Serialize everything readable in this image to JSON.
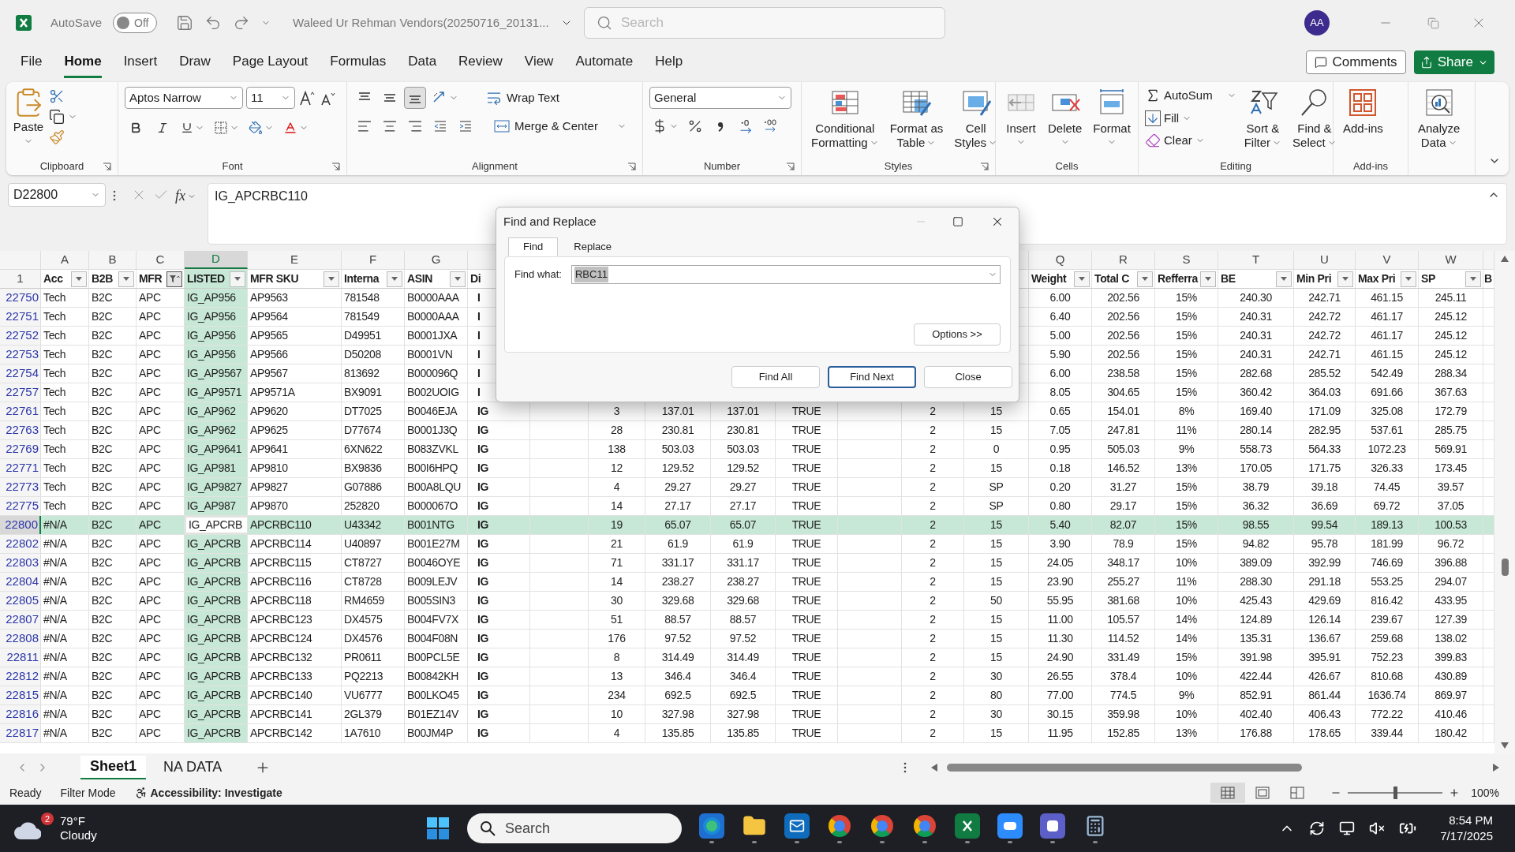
{
  "title_bar": {
    "autosave_label": "AutoSave",
    "autosave": {
      "on": false,
      "label": "Off"
    },
    "file_name": "Waleed Ur Rehman Vendors(20250716_20131...",
    "search": {
      "placeholder": "Search"
    },
    "avatar": "AA"
  },
  "menu_tabs": [
    {
      "label": "File",
      "selected": false
    },
    {
      "label": "Home",
      "selected": true
    },
    {
      "label": "Insert",
      "selected": false
    },
    {
      "label": "Draw",
      "selected": false
    },
    {
      "label": "Page Layout",
      "selected": false
    },
    {
      "label": "Formulas",
      "selected": false
    },
    {
      "label": "Data",
      "selected": false
    },
    {
      "label": "Review",
      "selected": false
    },
    {
      "label": "View",
      "selected": false
    },
    {
      "label": "Automate",
      "selected": false
    },
    {
      "label": "Help",
      "selected": false
    }
  ],
  "comments_button": "Comments",
  "share_button": "Share",
  "ribbon": {
    "clipboard": {
      "paste": "Paste",
      "label": "Clipboard"
    },
    "font": {
      "family": "Aptos Narrow",
      "size": "11",
      "label": "Font"
    },
    "alignment": {
      "vertical": [
        {
          "selected": false
        },
        {
          "selected": false
        },
        {
          "selected": true
        }
      ],
      "wrap": "Wrap Text",
      "merge": "Merge & Center",
      "label": "Alignment"
    },
    "number": {
      "format": "General",
      "label": "Number"
    },
    "styles": {
      "buttons": [
        {
          "kind": "conditional",
          "lines": [
            "Conditional",
            "Formatting"
          ]
        },
        {
          "kind": "table",
          "lines": [
            "Format as",
            "Table"
          ]
        },
        {
          "kind": "styles",
          "lines": [
            "Cell",
            "Styles"
          ]
        }
      ],
      "label": "Styles"
    },
    "cells": {
      "buttons": [
        {
          "kind": "insert",
          "lines": [
            "Insert"
          ]
        },
        {
          "kind": "delete",
          "lines": [
            "Delete"
          ]
        },
        {
          "kind": "format",
          "lines": [
            "Format"
          ]
        }
      ],
      "label": "Cells"
    },
    "editing": {
      "autosum": "AutoSum",
      "fill": "Fill",
      "clear": "Clear",
      "buttons": [
        {
          "kind": "sort",
          "lines": [
            "Sort &",
            "Filter"
          ]
        },
        {
          "kind": "find",
          "lines": [
            "Find &",
            "Select"
          ]
        }
      ],
      "label": "Editing"
    },
    "addins": {
      "buttons": [
        {
          "kind": "addins",
          "lines": [
            "Add-ins"
          ]
        }
      ],
      "label": "Add-ins"
    },
    "analyze": {
      "buttons": [
        {
          "kind": "analyze",
          "lines": [
            "Analyze",
            "Data"
          ]
        }
      ]
    }
  },
  "formula_bar": {
    "name_box": "D22800",
    "fx": "fx",
    "value": "IG_APCRBC110"
  },
  "columns": [
    {
      "letter": "A",
      "header": "Acc",
      "selected": false,
      "filtered": false
    },
    {
      "letter": "B",
      "header": "B2B",
      "selected": false,
      "filtered": false
    },
    {
      "letter": "C",
      "header": "MFR",
      "selected": false,
      "filtered": true
    },
    {
      "letter": "D",
      "header": "LISTED",
      "selected": true,
      "filtered": false
    },
    {
      "letter": "E",
      "header": "MFR SKU",
      "selected": false,
      "filtered": false
    },
    {
      "letter": "F",
      "header": "Interna",
      "selected": false,
      "filtered": false
    },
    {
      "letter": "G",
      "header": "ASIN",
      "selected": false,
      "filtered": false
    },
    {
      "header": "Di"
    },
    {},
    {},
    {},
    {},
    {},
    {},
    {},
    {},
    {
      "letter": "Q",
      "header": "Weight",
      "selected": false,
      "filtered": false
    },
    {
      "letter": "R",
      "header": "Total C",
      "selected": false,
      "filtered": false
    },
    {
      "letter": "S",
      "header": "Refferra",
      "selected": false,
      "filtered": false
    },
    {
      "letter": "T",
      "header": "BE",
      "selected": false,
      "filtered": false
    },
    {
      "letter": "U",
      "header": "Min Pri",
      "selected": false,
      "filtered": false
    },
    {
      "letter": "V",
      "header": "Max Pri",
      "selected": false,
      "filtered": false
    },
    {
      "letter": "W",
      "header": "SP",
      "selected": false,
      "filtered": false
    },
    {
      "header": "B"
    }
  ],
  "header_row_number": "1",
  "rows": [
    {
      "num": "22750",
      "selected": false,
      "cells": [
        "Tech",
        "B2C",
        "APC",
        "IG_AP956",
        "AP9563",
        "781548",
        "B0000AAA",
        "I",
        null,
        null,
        null,
        null,
        null,
        null,
        null,
        null,
        "6.00",
        "202.56",
        "15%",
        "240.30",
        "242.71",
        "461.15",
        "245.11"
      ]
    },
    {
      "num": "22751",
      "selected": false,
      "cells": [
        "Tech",
        "B2C",
        "APC",
        "IG_AP956",
        "AP9564",
        "781549",
        "B0000AAA",
        "I",
        null,
        null,
        null,
        null,
        null,
        null,
        null,
        null,
        "6.40",
        "202.56",
        "15%",
        "240.31",
        "242.72",
        "461.17",
        "245.12"
      ]
    },
    {
      "num": "22752",
      "selected": false,
      "cells": [
        "Tech",
        "B2C",
        "APC",
        "IG_AP956",
        "AP9565",
        "D49951",
        "B0001JXA",
        "I",
        null,
        null,
        null,
        null,
        null,
        null,
        null,
        null,
        "5.00",
        "202.56",
        "15%",
        "240.31",
        "242.72",
        "461.17",
        "245.12"
      ]
    },
    {
      "num": "22753",
      "selected": false,
      "cells": [
        "Tech",
        "B2C",
        "APC",
        "IG_AP956",
        "AP9566",
        "D50208",
        "B0001VN",
        "I",
        null,
        null,
        null,
        null,
        null,
        null,
        null,
        null,
        "5.90",
        "202.56",
        "15%",
        "240.31",
        "242.71",
        "461.15",
        "245.12"
      ]
    },
    {
      "num": "22754",
      "selected": false,
      "cells": [
        "Tech",
        "B2C",
        "APC",
        "IG_AP9567",
        "AP9567",
        "813692",
        "B000096Q",
        "I",
        null,
        null,
        null,
        null,
        null,
        null,
        null,
        null,
        "6.00",
        "238.58",
        "15%",
        "282.68",
        "285.52",
        "542.49",
        "288.34"
      ]
    },
    {
      "num": "22757",
      "selected": false,
      "cells": [
        "Tech",
        "B2C",
        "APC",
        "IG_AP9571",
        "AP9571A",
        "BX9091",
        "B002UOIG",
        "I",
        null,
        null,
        null,
        null,
        null,
        null,
        null,
        null,
        "8.05",
        "304.65",
        "15%",
        "360.42",
        "364.03",
        "691.66",
        "367.63"
      ]
    },
    {
      "num": "22761",
      "selected": false,
      "cells": [
        "Tech",
        "B2C",
        "APC",
        "IG_AP962",
        "AP9620",
        "DT7025",
        "B0046EJA",
        "IG",
        null,
        "3",
        "137.01",
        "137.01",
        "TRUE",
        null,
        "2",
        "15",
        "0.65",
        "154.01",
        "8%",
        "169.40",
        "171.09",
        "325.08",
        "172.79"
      ]
    },
    {
      "num": "22763",
      "selected": false,
      "cells": [
        "Tech",
        "B2C",
        "APC",
        "IG_AP962",
        "AP9625",
        "D77674",
        "B0001J3Q",
        "IG",
        null,
        "28",
        "230.81",
        "230.81",
        "TRUE",
        null,
        "2",
        "15",
        "7.05",
        "247.81",
        "11%",
        "280.14",
        "282.95",
        "537.61",
        "285.75"
      ]
    },
    {
      "num": "22769",
      "selected": false,
      "cells": [
        "Tech",
        "B2C",
        "APC",
        "IG_AP9641",
        "AP9641",
        "6XN622",
        "B083ZVKL",
        "IG",
        null,
        "138",
        "503.03",
        "503.03",
        "TRUE",
        null,
        "2",
        "0",
        "0.95",
        "505.03",
        "9%",
        "558.73",
        "564.33",
        "1072.23",
        "569.91"
      ]
    },
    {
      "num": "22771",
      "selected": false,
      "cells": [
        "Tech",
        "B2C",
        "APC",
        "IG_AP981",
        "AP9810",
        "BX9836",
        "B00I6HPQ",
        "IG",
        null,
        "12",
        "129.52",
        "129.52",
        "TRUE",
        null,
        "2",
        "15",
        "0.18",
        "146.52",
        "13%",
        "170.05",
        "171.75",
        "326.33",
        "173.45"
      ]
    },
    {
      "num": "22773",
      "selected": false,
      "cells": [
        "Tech",
        "B2C",
        "APC",
        "IG_AP9827",
        "AP9827",
        "G07886",
        "B00A8LQU",
        "IG",
        null,
        "4",
        "29.27",
        "29.27",
        "TRUE",
        null,
        "2",
        "SP",
        "0.20",
        "31.27",
        "15%",
        "38.79",
        "39.18",
        "74.45",
        "39.57"
      ]
    },
    {
      "num": "22775",
      "selected": false,
      "cells": [
        "Tech",
        "B2C",
        "APC",
        "IG_AP987",
        "AP9870",
        "252820",
        "B000067O",
        "IG",
        null,
        "14",
        "27.17",
        "27.17",
        "TRUE",
        null,
        "2",
        "SP",
        "0.80",
        "29.17",
        "15%",
        "36.32",
        "36.69",
        "69.72",
        "37.05"
      ]
    },
    {
      "num": "22800",
      "selected": true,
      "cells": [
        "#N/A",
        "B2C",
        "APC",
        "IG_APCRB",
        "APCRBC110",
        "U43342",
        "B001NTG",
        "IG",
        null,
        "19",
        "65.07",
        "65.07",
        "TRUE",
        null,
        "2",
        "15",
        "5.40",
        "82.07",
        "15%",
        "98.55",
        "99.54",
        "189.13",
        "100.53"
      ]
    },
    {
      "num": "22802",
      "selected": false,
      "cells": [
        "#N/A",
        "B2C",
        "APC",
        "IG_APCRB",
        "APCRBC114",
        "U40897",
        "B001E27M",
        "IG",
        null,
        "21",
        "61.9",
        "61.9",
        "TRUE",
        null,
        "2",
        "15",
        "3.90",
        "78.9",
        "15%",
        "94.82",
        "95.78",
        "181.99",
        "96.72"
      ]
    },
    {
      "num": "22803",
      "selected": false,
      "cells": [
        "#N/A",
        "B2C",
        "APC",
        "IG_APCRB",
        "APCRBC115",
        "CT8727",
        "B0046OYE",
        "IG",
        null,
        "71",
        "331.17",
        "331.17",
        "TRUE",
        null,
        "2",
        "15",
        "24.05",
        "348.17",
        "10%",
        "389.09",
        "392.99",
        "746.69",
        "396.88"
      ]
    },
    {
      "num": "22804",
      "selected": false,
      "cells": [
        "#N/A",
        "B2C",
        "APC",
        "IG_APCRB",
        "APCRBC116",
        "CT8728",
        "B009LEJV",
        "IG",
        null,
        "14",
        "238.27",
        "238.27",
        "TRUE",
        null,
        "2",
        "15",
        "23.90",
        "255.27",
        "11%",
        "288.30",
        "291.18",
        "553.25",
        "294.07"
      ]
    },
    {
      "num": "22805",
      "selected": false,
      "cells": [
        "#N/A",
        "B2C",
        "APC",
        "IG_APCRB",
        "APCRBC118",
        "RM4659",
        "B005SIN3",
        "IG",
        null,
        "30",
        "329.68",
        "329.68",
        "TRUE",
        null,
        "2",
        "50",
        "55.95",
        "381.68",
        "10%",
        "425.43",
        "429.69",
        "816.42",
        "433.95"
      ]
    },
    {
      "num": "22807",
      "selected": false,
      "cells": [
        "#N/A",
        "B2C",
        "APC",
        "IG_APCRB",
        "APCRBC123",
        "DX4575",
        "B004FV7X",
        "IG",
        null,
        "51",
        "88.57",
        "88.57",
        "TRUE",
        null,
        "2",
        "15",
        "11.00",
        "105.57",
        "14%",
        "124.89",
        "126.14",
        "239.67",
        "127.39"
      ]
    },
    {
      "num": "22808",
      "selected": false,
      "cells": [
        "#N/A",
        "B2C",
        "APC",
        "IG_APCRB",
        "APCRBC124",
        "DX4576",
        "B004F08N",
        "IG",
        null,
        "176",
        "97.52",
        "97.52",
        "TRUE",
        null,
        "2",
        "15",
        "11.30",
        "114.52",
        "14%",
        "135.31",
        "136.67",
        "259.68",
        "138.02"
      ]
    },
    {
      "num": "22811",
      "selected": false,
      "cells": [
        "#N/A",
        "B2C",
        "APC",
        "IG_APCRB",
        "APCRBC132",
        "PR0611",
        "B00PCL5E",
        "IG",
        null,
        "8",
        "314.49",
        "314.49",
        "TRUE",
        null,
        "2",
        "15",
        "24.90",
        "331.49",
        "15%",
        "391.98",
        "395.91",
        "752.23",
        "399.83"
      ]
    },
    {
      "num": "22812",
      "selected": false,
      "cells": [
        "#N/A",
        "B2C",
        "APC",
        "IG_APCRB",
        "APCRBC133",
        "PQ2213",
        "B00842KH",
        "IG",
        null,
        "13",
        "346.4",
        "346.4",
        "TRUE",
        null,
        "2",
        "30",
        "26.55",
        "378.4",
        "10%",
        "422.44",
        "426.67",
        "810.68",
        "430.89"
      ]
    },
    {
      "num": "22815",
      "selected": false,
      "cells": [
        "#N/A",
        "B2C",
        "APC",
        "IG_APCRB",
        "APCRBC140",
        "VU6777",
        "B00LKO45",
        "IG",
        null,
        "234",
        "692.5",
        "692.5",
        "TRUE",
        null,
        "2",
        "80",
        "77.00",
        "774.5",
        "9%",
        "852.91",
        "861.44",
        "1636.74",
        "869.97"
      ]
    },
    {
      "num": "22816",
      "selected": false,
      "cells": [
        "#N/A",
        "B2C",
        "APC",
        "IG_APCRB",
        "APCRBC141",
        "2GL379",
        "B01EZ14V",
        "IG",
        null,
        "10",
        "327.98",
        "327.98",
        "TRUE",
        null,
        "2",
        "30",
        "30.15",
        "359.98",
        "10%",
        "402.40",
        "406.43",
        "772.22",
        "410.46"
      ]
    },
    {
      "num": "22817",
      "selected": false,
      "cells": [
        "#N/A",
        "B2C",
        "APC",
        "IG_APCRB",
        "APCRBC142",
        "1A7610",
        "B00JM4P",
        "IG",
        null,
        "4",
        "135.85",
        "135.85",
        "TRUE",
        null,
        "2",
        "15",
        "11.95",
        "152.85",
        "13%",
        "176.88",
        "178.65",
        "339.44",
        "180.42"
      ]
    }
  ],
  "dialog": {
    "title": "Find and Replace",
    "tabs": [
      {
        "label": "Find",
        "selected": true
      },
      {
        "label": "Replace",
        "selected": false
      }
    ],
    "find_label": "Find what:",
    "find_value": "RBC11",
    "options_button": "Options >>",
    "buttons": [
      {
        "label": "Find All",
        "default": false
      },
      {
        "label": "Find Next",
        "default": true
      },
      {
        "label": "Close",
        "default": false
      }
    ]
  },
  "sheet_tabs": [
    {
      "label": "Sheet1",
      "selected": true
    },
    {
      "label": "NA DATA",
      "selected": false
    }
  ],
  "status_bar": {
    "ready": "Ready",
    "mode": "Filter Mode",
    "accessibility": "Accessibility: Investigate",
    "views": [
      {
        "selected": true
      },
      {
        "selected": false
      },
      {
        "selected": false
      }
    ],
    "zoom": {
      "level": 0.5
    },
    "zoom_label": "100%"
  },
  "taskbar": {
    "weather": {
      "temp": "79°F",
      "condition": "Cloudy",
      "badge": "2"
    },
    "search": {
      "placeholder": "Search"
    },
    "time": "8:54 PM",
    "date": "7/17/2025"
  }
}
